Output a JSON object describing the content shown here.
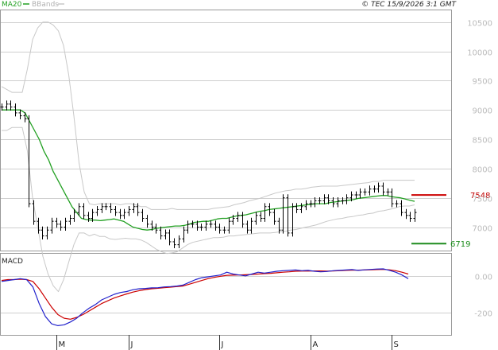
{
  "legend": {
    "ma_label": "MA20",
    "bb_label": "BBands"
  },
  "credit": "© TEC 15/9/2026 3:1 GMT",
  "chart_data": {
    "type": "line",
    "price_axis": {
      "ticks": [
        7000,
        7500,
        8000,
        8500,
        9000,
        9500,
        10000,
        10500
      ],
      "tick_labels": [
        "7000",
        "7500",
        "8000",
        "8500",
        "9000",
        "9500",
        "10000",
        "10500"
      ],
      "ylim": [
        6600,
        10700
      ],
      "grid": true
    },
    "macd_axis": {
      "title": "MACD",
      "ticks": [
        0,
        -200
      ],
      "tick_labels": [
        "0.00",
        "-200"
      ],
      "ylim": [
        -320,
        120
      ]
    },
    "month_labels": [
      {
        "label": "M",
        "idx": 12
      },
      {
        "label": "J",
        "idx": 28
      },
      {
        "label": "J",
        "idx": 48
      },
      {
        "label": "A",
        "idx": 68
      },
      {
        "label": "S",
        "idx": 86
      }
    ],
    "resistance": {
      "value": 7548,
      "label": "7548",
      "color": "#cc0000"
    },
    "support": {
      "value": 6719,
      "label": "6719",
      "color": "#1e8c1e"
    },
    "colors": {
      "ma": "#22a022",
      "bands": "#c8c8c8",
      "bars": "#000000",
      "macd": "#2222cc",
      "signal": "#cc0000",
      "grid": "#cfcfcf"
    },
    "price": {
      "close": [
        9050,
        9100,
        9050,
        8950,
        8900,
        8850,
        7400,
        7100,
        6950,
        6850,
        6950,
        7100,
        7050,
        7000,
        7100,
        7150,
        7250,
        7350,
        7200,
        7150,
        7250,
        7300,
        7350,
        7350,
        7300,
        7250,
        7200,
        7250,
        7300,
        7350,
        7250,
        7150,
        7050,
        7000,
        6950,
        6850,
        6900,
        6750,
        6700,
        6800,
        6950,
        7050,
        7050,
        7000,
        7000,
        7050,
        7050,
        7000,
        6950,
        6950,
        7100,
        7150,
        7200,
        7050,
        6950,
        7100,
        7200,
        7150,
        7350,
        7250,
        7100,
        6950,
        7500,
        6900,
        7350,
        7300,
        7350,
        7400,
        7400,
        7450,
        7450,
        7500,
        7450,
        7400,
        7450,
        7450,
        7500,
        7550,
        7550,
        7600,
        7600,
        7650,
        7650,
        7700,
        7600,
        7600,
        7400,
        7400,
        7250,
        7200,
        7150,
        7250
      ],
      "ma20": [
        9000,
        9000,
        9000,
        9000,
        9000,
        8950,
        8800,
        8650,
        8500,
        8300,
        8150,
        7950,
        7800,
        7650,
        7500,
        7350,
        7250,
        7150,
        7130,
        7120,
        7120,
        7110,
        7120,
        7130,
        7140,
        7120,
        7100,
        7050,
        7000,
        6980,
        6960,
        6950,
        6960,
        6980,
        6990,
        7000,
        7010,
        7020,
        7020,
        7030,
        7050,
        7080,
        7090,
        7100,
        7100,
        7120,
        7140,
        7150,
        7150,
        7170,
        7190,
        7200,
        7210,
        7230,
        7250,
        7270,
        7280,
        7300,
        7310,
        7320,
        7330,
        7340,
        7350,
        7360,
        7370,
        7380,
        7390,
        7400,
        7400,
        7400,
        7420,
        7430,
        7440,
        7450,
        7460,
        7470,
        7490,
        7500,
        7510,
        7520,
        7530,
        7540,
        7540,
        7520,
        7510,
        7500,
        7480,
        7460,
        7440
      ]
    },
    "bollinger": {
      "upper": [
        9400,
        9350,
        9300,
        9300,
        9300,
        9700,
        10200,
        10400,
        10500,
        10500,
        10450,
        10350,
        10100,
        9600,
        8900,
        8100,
        7600,
        7400,
        7380,
        7400,
        7400,
        7400,
        7400,
        7380,
        7400,
        7400,
        7380,
        7350,
        7350,
        7300,
        7300,
        7300,
        7300,
        7320,
        7300,
        7300,
        7300,
        7300,
        7300,
        7300,
        7300,
        7320,
        7330,
        7340,
        7350,
        7380,
        7400,
        7420,
        7450,
        7470,
        7490,
        7520,
        7550,
        7580,
        7600,
        7620,
        7630,
        7650,
        7650,
        7660,
        7680,
        7690,
        7700,
        7700,
        7700,
        7700,
        7710,
        7720,
        7730,
        7740,
        7750,
        7760,
        7780,
        7780,
        7800,
        7800,
        7800,
        7800,
        7800,
        7800,
        7800
      ],
      "lower": [
        8650,
        8650,
        8700,
        8700,
        8700,
        8300,
        7500,
        7000,
        6500,
        6200,
        6000,
        5900,
        6100,
        6400,
        6700,
        6900,
        6900,
        6850,
        6880,
        6840,
        6840,
        6800,
        6790,
        6800,
        6810,
        6800,
        6800,
        6780,
        6740,
        6680,
        6620,
        6580,
        6550,
        6560,
        6580,
        6640,
        6700,
        6740,
        6760,
        6780,
        6800,
        6820,
        6820,
        6830,
        6850,
        6850,
        6860,
        6870,
        6880,
        6890,
        6900,
        6900,
        6900,
        6910,
        6920,
        6930,
        6950,
        6960,
        6980,
        7000,
        7020,
        7040,
        7070,
        7100,
        7120,
        7140,
        7150,
        7170,
        7180,
        7200,
        7210,
        7230,
        7240,
        7270,
        7280,
        7300,
        7320,
        7350,
        7360,
        7360,
        7380
      ]
    },
    "macd": {
      "macd": [
        -30,
        -25,
        -20,
        -15,
        -20,
        -60,
        -150,
        -220,
        -260,
        -270,
        -265,
        -250,
        -230,
        -200,
        -175,
        -155,
        -130,
        -115,
        -100,
        -90,
        -85,
        -75,
        -70,
        -68,
        -65,
        -64,
        -60,
        -58,
        -55,
        -50,
        -35,
        -20,
        -10,
        -5,
        0,
        5,
        20,
        10,
        5,
        0,
        10,
        20,
        15,
        20,
        25,
        28,
        30,
        32,
        28,
        30,
        25,
        22,
        24,
        28,
        30,
        32,
        34,
        30,
        33,
        35,
        37,
        38,
        30,
        20,
        5,
        -15
      ],
      "signal": [
        -25,
        -20,
        -20,
        -18,
        -20,
        -30,
        -70,
        -120,
        -170,
        -210,
        -230,
        -235,
        -225,
        -210,
        -190,
        -170,
        -150,
        -135,
        -120,
        -108,
        -98,
        -88,
        -80,
        -74,
        -70,
        -67,
        -64,
        -61,
        -58,
        -55,
        -45,
        -35,
        -25,
        -15,
        -8,
        -2,
        3,
        4,
        5,
        6,
        8,
        10,
        12,
        14,
        17,
        20,
        22,
        25,
        26,
        26,
        27,
        27,
        26,
        27,
        28,
        30,
        31,
        31,
        32,
        33,
        34,
        35,
        33,
        28,
        20,
        10
      ]
    }
  }
}
